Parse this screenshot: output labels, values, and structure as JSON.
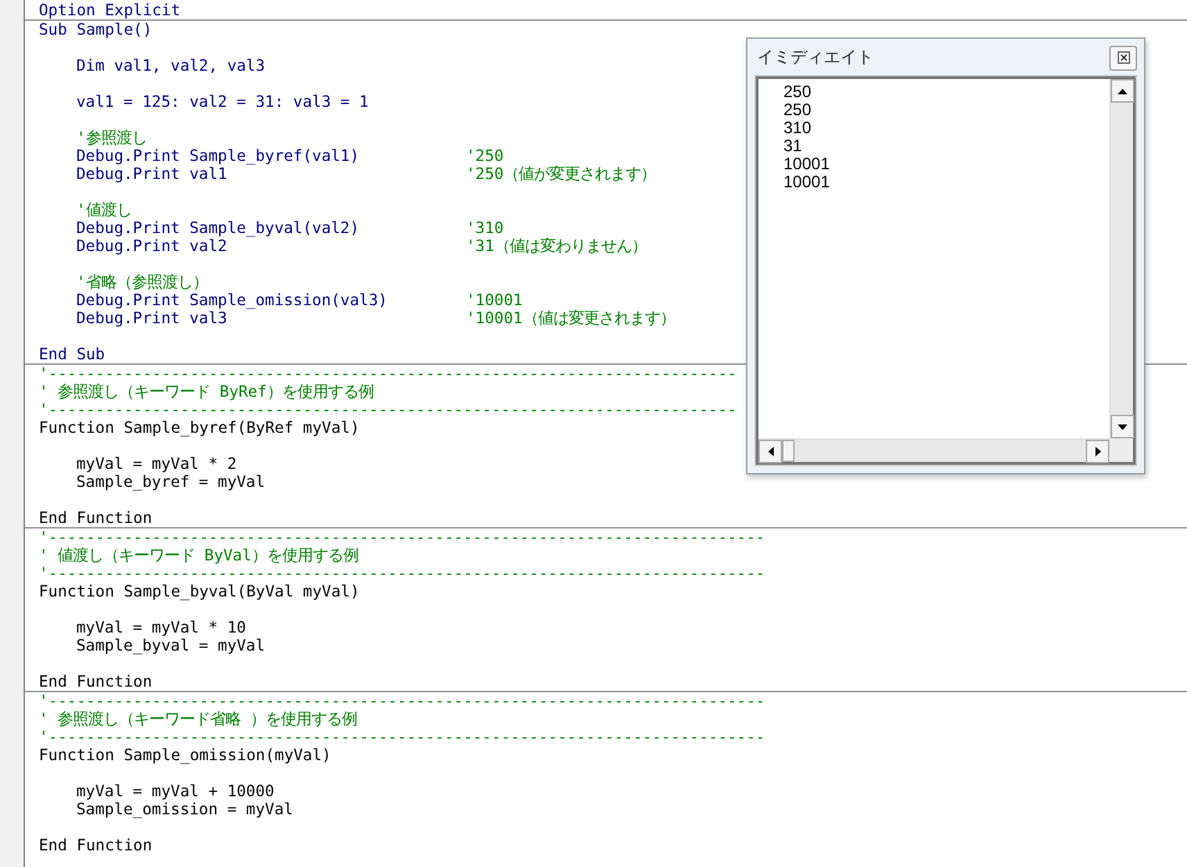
{
  "editor": {
    "sections": [
      {
        "kind": "declarations",
        "color": "#00007f",
        "lines": [
          {
            "text": "Option Explicit"
          }
        ]
      },
      {
        "kind": "procedure",
        "color": "#00007f",
        "signature": "Sub Sample()",
        "body": [
          {
            "kind": "blank"
          },
          {
            "kind": "code",
            "text": "Dim val1, val2, val3"
          },
          {
            "kind": "blank"
          },
          {
            "kind": "code",
            "text": "val1 = 125: val2 = 31: val3 = 1"
          },
          {
            "kind": "blank"
          },
          {
            "kind": "comment",
            "text": "'参照渡し"
          },
          {
            "kind": "code",
            "text": "Debug.Print Sample_byref(val1)",
            "comment": "'250"
          },
          {
            "kind": "code",
            "text": "Debug.Print val1",
            "comment": "'250（値が変更されます）"
          },
          {
            "kind": "blank"
          },
          {
            "kind": "comment",
            "text": "'値渡し"
          },
          {
            "kind": "code",
            "text": "Debug.Print Sample_byval(val2)",
            "comment": "'310"
          },
          {
            "kind": "code",
            "text": "Debug.Print val2",
            "comment": "'31（値は変わりません）"
          },
          {
            "kind": "blank"
          },
          {
            "kind": "comment",
            "text": "'省略（参照渡し）"
          },
          {
            "kind": "code",
            "text": "Debug.Print Sample_omission(val3)",
            "comment": "'10001"
          },
          {
            "kind": "code",
            "text": "Debug.Print val3",
            "comment": "'10001（値は変更されます）"
          },
          {
            "kind": "blank"
          }
        ],
        "end": "End Sub"
      },
      {
        "kind": "procedure",
        "color": "#000000",
        "header": [
          "'-------------------------------------------------------------------------",
          "' 参照渡し（キーワード ByRef）を使用する例",
          "'-------------------------------------------------------------------------"
        ],
        "signature": "Function Sample_byref(ByRef myVal)",
        "body": [
          {
            "kind": "blank"
          },
          {
            "kind": "code",
            "text": "myVal = myVal * 2"
          },
          {
            "kind": "code",
            "text": "Sample_byref = myVal"
          },
          {
            "kind": "blank"
          }
        ],
        "end": "End Function"
      },
      {
        "kind": "procedure",
        "color": "#000000",
        "header": [
          "'----------------------------------------------------------------------------",
          "' 値渡し（キーワード ByVal）を使用する例",
          "'----------------------------------------------------------------------------"
        ],
        "signature": "Function Sample_byval(ByVal myVal)",
        "body": [
          {
            "kind": "blank"
          },
          {
            "kind": "code",
            "text": "myVal = myVal * 10"
          },
          {
            "kind": "code",
            "text": "Sample_byval = myVal"
          },
          {
            "kind": "blank"
          }
        ],
        "end": "End Function"
      },
      {
        "kind": "procedure",
        "color": "#000000",
        "header": [
          "'----------------------------------------------------------------------------",
          "' 参照渡し（キーワード省略 ）を使用する例",
          "'----------------------------------------------------------------------------"
        ],
        "signature": "Function Sample_omission(myVal)",
        "body": [
          {
            "kind": "blank"
          },
          {
            "kind": "code",
            "text": "myVal = myVal + 10000"
          },
          {
            "kind": "code",
            "text": "Sample_omission = myVal"
          },
          {
            "kind": "blank"
          }
        ],
        "end": "End Function"
      }
    ]
  },
  "immediate_window": {
    "title": "イミディエイト",
    "output": [
      "250",
      "250",
      "310",
      "31",
      "10001",
      "10001"
    ]
  }
}
